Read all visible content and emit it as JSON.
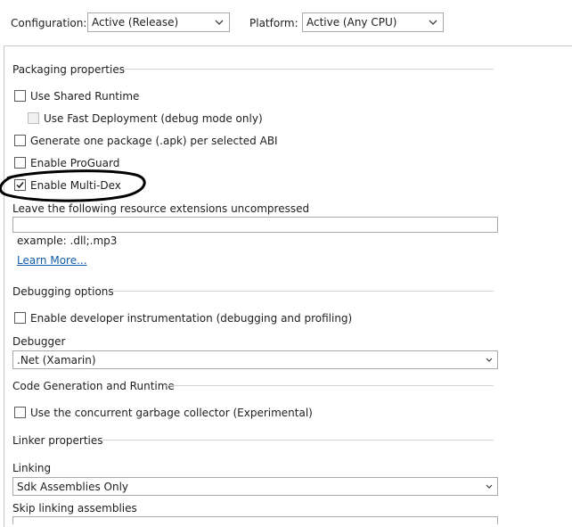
{
  "toolbar": {
    "configuration_label": "Configuration:",
    "configuration_value": "Active (Release)",
    "platform_label": "Platform:",
    "platform_value": "Active (Any CPU)"
  },
  "packaging": {
    "heading": "Packaging properties",
    "use_shared_runtime": "Use Shared Runtime",
    "use_fast_deployment": "Use Fast Deployment (debug mode only)",
    "generate_one_package": "Generate one package (.apk) per selected ABI",
    "enable_proguard": "Enable ProGuard",
    "enable_multidex": "Enable Multi-Dex",
    "uncompressed_label": "Leave the following resource extensions uncompressed",
    "uncompressed_value": "",
    "example_text": "example: .dll;.mp3",
    "learn_more": "Learn More...",
    "checked": {
      "use_shared_runtime": false,
      "use_fast_deployment": false,
      "generate_one_package": false,
      "enable_proguard": false,
      "enable_multidex": true
    }
  },
  "debugging": {
    "heading": "Debugging options",
    "enable_instrumentation": "Enable developer instrumentation (debugging and profiling)",
    "debugger_label": "Debugger",
    "debugger_value": ".Net (Xamarin)"
  },
  "codegen": {
    "heading": "Code Generation and Runtime",
    "concurrent_gc": "Use the concurrent garbage collector (Experimental)"
  },
  "linker": {
    "heading": "Linker properties",
    "linking_label": "Linking",
    "linking_value": "Sdk Assemblies Only",
    "skip_label": "Skip linking assemblies",
    "skip_value": ""
  },
  "colors": {
    "link": "#0e5aa7",
    "border": "#a9a9a9",
    "annotation": "#000000"
  }
}
